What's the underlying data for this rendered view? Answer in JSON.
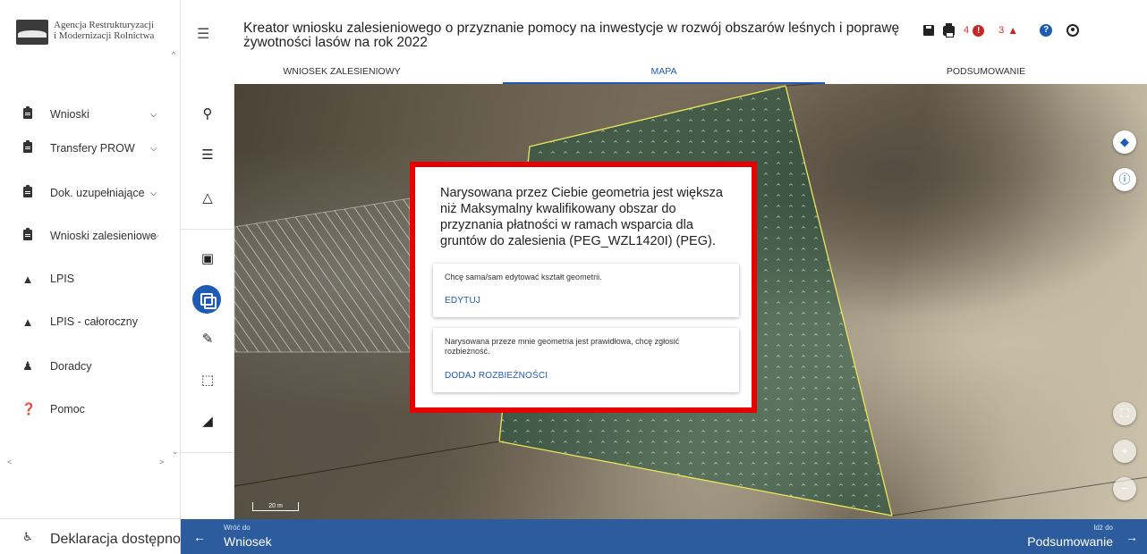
{
  "org": {
    "line1": "Agencja Restrukturyzacji",
    "line2": "i Modernizacji Rolnictwa"
  },
  "sidebar": {
    "items": [
      {
        "label": "Wnioski",
        "icon": "clipboard-icon",
        "has_chevron": true
      },
      {
        "label": "Transfery PROW",
        "icon": "clipboard-icon",
        "has_chevron": true
      },
      {
        "label": "Dok. uzupełniające",
        "icon": "clipboard-icon",
        "has_chevron": true
      },
      {
        "label": "Wnioski zalesieniowe",
        "icon": "clipboard-icon",
        "has_chevron": true
      },
      {
        "label": "LPIS",
        "icon": "terrain-icon",
        "has_chevron": false
      },
      {
        "label": "LPIS - całoroczny",
        "icon": "terrain-icon",
        "has_chevron": false
      },
      {
        "label": "Doradcy",
        "icon": "person-icon",
        "has_chevron": false
      },
      {
        "label": "Pomoc",
        "icon": "help-circle-icon",
        "has_chevron": false
      }
    ],
    "footer_label": "Deklaracja dostępności"
  },
  "header": {
    "title": "Kreator wniosku zalesieniowego o przyznanie pomocy na inwestycje w rozwój obszarów leśnych i poprawę żywotności lasów na rok 2022",
    "alerts_count": "4",
    "notifications_count": "3"
  },
  "tabs": [
    {
      "label": "WNIOSEK ZALESIENIOWY",
      "active": false
    },
    {
      "label": "MAPA",
      "active": true
    },
    {
      "label": "PODSUMOWANIE",
      "active": false
    }
  ],
  "map": {
    "scale_label": "20 m"
  },
  "dialog": {
    "message": "Narysowana przez Ciebie geometria jest większa niż Maksymalny kwalifikowany obszar do przyznania płatności w ramach wsparcia dla gruntów do zalesienia (PEG_WZL1420I) (PEG).",
    "option1": {
      "text": "Chcę sama/sam edytować kształt geometrii.",
      "button": "EDYTUJ"
    },
    "option2": {
      "text": "Narysowana przeze mnie geometria jest prawidłowa, chcę zgłosić rozbieżność.",
      "button": "DODAJ ROZBIEŻNOŚCI"
    }
  },
  "footer": {
    "back_small": "Wróć do",
    "back_big": "Wniosek",
    "next_small": "Idź do",
    "next_big": "Podsumowanie"
  },
  "colors": {
    "primary": "#1e5bb5",
    "footer_bar": "#2d5c9e",
    "dialog_border": "#e60000",
    "alert": "#c62828"
  }
}
